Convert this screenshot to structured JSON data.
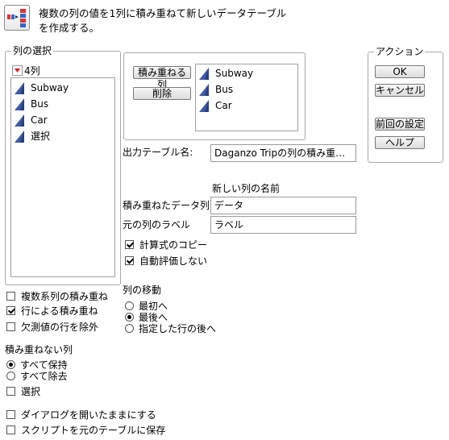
{
  "header": {
    "icon": "stack-columns-icon",
    "description_line1": "複数の列の値を1列に積み重ねて新しいデータテーブル",
    "description_line2": "を作成する。"
  },
  "select_columns": {
    "title": "列の選択",
    "count_label": "4列",
    "items": [
      "Subway",
      "Bus",
      "Car",
      "選択"
    ]
  },
  "cast": {
    "stack_button": "積み重ねる列",
    "remove_button": "削除",
    "items": [
      "Subway",
      "Bus",
      "Car"
    ]
  },
  "actions": {
    "title": "アクション",
    "ok": "OK",
    "cancel": "キャンセル",
    "recall": "前回の設定",
    "help": "ヘルプ"
  },
  "output": {
    "table_name_label": "出力テーブル名:",
    "table_name_value": "Daganzo Tripの列の積み重…",
    "new_col_heading": "新しい列の名前",
    "stacked_data_label": "積み重ねたデータ列",
    "stacked_data_value": "データ",
    "source_label_label": "元の列のラベル",
    "source_label_value": "ラベル",
    "copy_formula": "計算式のコピー",
    "no_auto_eval": "自動評価しない"
  },
  "options": {
    "multi_series": "複数系列の積み重ね",
    "stack_by_row": "行による積み重ね",
    "drop_missing": "欠測値の行を除外"
  },
  "move_columns": {
    "title": "列の移動",
    "first": "最初へ",
    "last": "最後へ",
    "after": "指定した行の後へ"
  },
  "non_stacked": {
    "title": "積み重ねない列",
    "keep_all": "すべて保持",
    "drop_all": "すべて除去",
    "select": "選択"
  },
  "footer": {
    "keep_dialog_open": "ダイアログを開いたままにする",
    "save_script": "スクリプトを元のテーブルに保存"
  },
  "colors": {
    "triangle": "#3a5ba8",
    "count_arrow": "#cc2222"
  }
}
